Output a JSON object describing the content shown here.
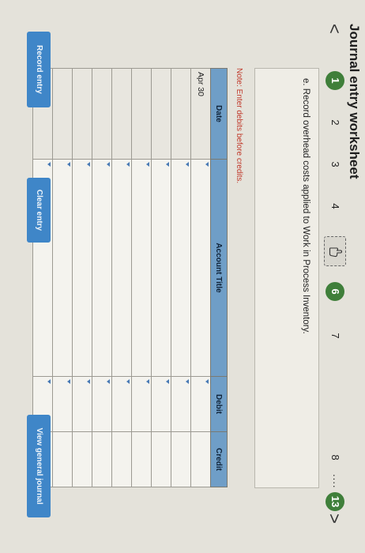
{
  "worksheet": {
    "title": "Journal entry worksheet",
    "nav": {
      "prev": "<",
      "next": ">",
      "steps": [
        "1",
        "2",
        "3",
        "4",
        "",
        "6",
        "7",
        "8",
        "....",
        "13"
      ]
    },
    "prompt": "e. Record overhead costs applied to Work in Process Inventory.",
    "note": "Note: Enter debits before credits.",
    "table": {
      "headers": {
        "date": "Date",
        "account": "Account Title",
        "debit": "Debit",
        "credit": "Credit"
      },
      "rows": [
        {
          "date": "Apr 30",
          "account": "",
          "debit": "",
          "credit": ""
        },
        {
          "date": "",
          "account": "",
          "debit": "",
          "credit": ""
        },
        {
          "date": "",
          "account": "",
          "debit": "",
          "credit": ""
        },
        {
          "date": "",
          "account": "",
          "debit": "",
          "credit": ""
        },
        {
          "date": "",
          "account": "",
          "debit": "",
          "credit": ""
        },
        {
          "date": "",
          "account": "",
          "debit": "",
          "credit": ""
        },
        {
          "date": "",
          "account": "",
          "debit": "",
          "credit": ""
        },
        {
          "date": "",
          "account": "",
          "debit": "",
          "credit": ""
        },
        {
          "date": "",
          "account": "",
          "debit": "",
          "credit": ""
        }
      ]
    },
    "buttons": {
      "record": "Record entry",
      "clear": "Clear entry",
      "view_journal": "View general journal"
    }
  },
  "colors": {
    "header_blue": "#6f9ec7",
    "button_blue": "#3f86c8",
    "done_green": "#3f7f3a",
    "note_red": "#c0392b"
  },
  "icons": {
    "current_step": "hand-pointer-icon"
  }
}
